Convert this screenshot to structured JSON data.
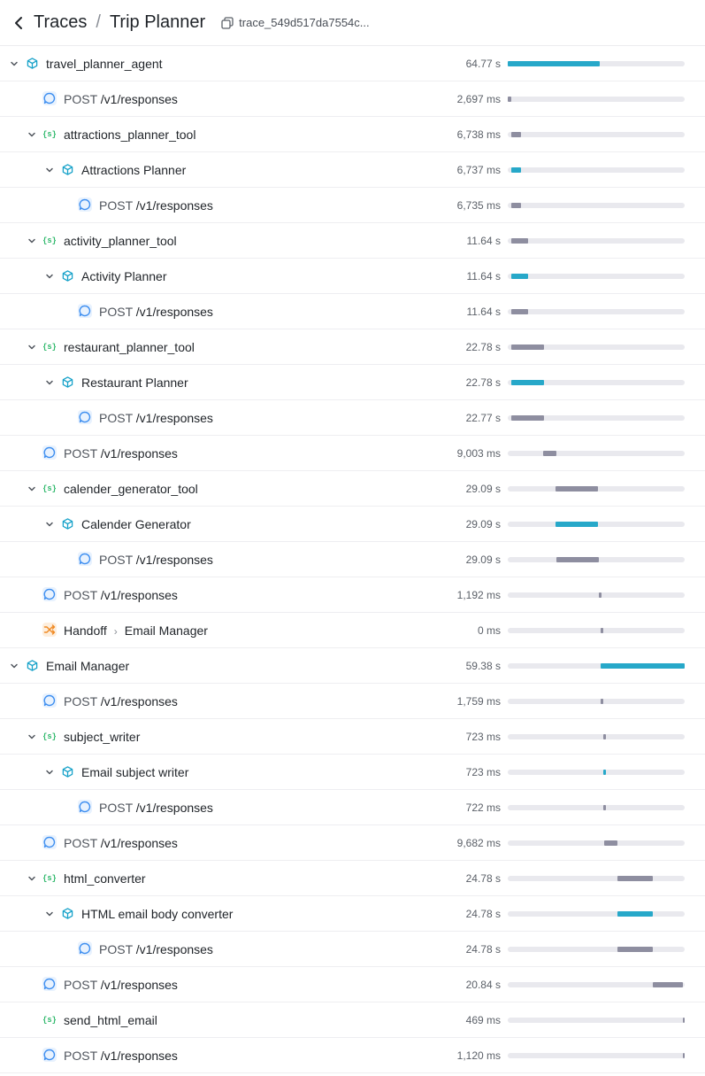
{
  "header": {
    "back_label": "Traces",
    "separator": "/",
    "title": "Trip Planner",
    "trace_id": "trace_549d517da7554c..."
  },
  "colors": {
    "agent_bar": "#27a8c9",
    "span_bar": "#8e8ea0",
    "track": "#e9e9ee",
    "agent_icon": "#17a2c9",
    "function_icon": "#2fb86b",
    "response_icon": "#3d8ef0",
    "handoff_icon": "#f08a24"
  },
  "spans": [
    {
      "type": "agent",
      "depth": 0,
      "expandable": true,
      "name": "travel_planner_agent",
      "duration": "64.77 s",
      "start_pct": 0.0,
      "width_pct": 52.0
    },
    {
      "type": "response",
      "depth": 1,
      "expandable": false,
      "method": "POST",
      "name": "/v1/responses",
      "duration": "2,697 ms",
      "start_pct": 0.0,
      "width_pct": 2.2
    },
    {
      "type": "function",
      "depth": 1,
      "expandable": true,
      "name": "attractions_planner_tool",
      "duration": "6,738 ms",
      "start_pct": 2.0,
      "width_pct": 5.5
    },
    {
      "type": "agent",
      "depth": 2,
      "expandable": true,
      "name": "Attractions Planner",
      "duration": "6,737 ms",
      "start_pct": 2.0,
      "width_pct": 5.5
    },
    {
      "type": "response",
      "depth": 3,
      "expandable": false,
      "method": "POST",
      "name": "/v1/responses",
      "duration": "6,735 ms",
      "start_pct": 2.0,
      "width_pct": 5.5
    },
    {
      "type": "function",
      "depth": 1,
      "expandable": true,
      "name": "activity_planner_tool",
      "duration": "11.64 s",
      "start_pct": 2.0,
      "width_pct": 9.5
    },
    {
      "type": "agent",
      "depth": 2,
      "expandable": true,
      "name": "Activity Planner",
      "duration": "11.64 s",
      "start_pct": 2.0,
      "width_pct": 9.5
    },
    {
      "type": "response",
      "depth": 3,
      "expandable": false,
      "method": "POST",
      "name": "/v1/responses",
      "duration": "11.64 s",
      "start_pct": 2.0,
      "width_pct": 9.5
    },
    {
      "type": "function",
      "depth": 1,
      "expandable": true,
      "name": "restaurant_planner_tool",
      "duration": "22.78 s",
      "start_pct": 2.0,
      "width_pct": 18.5
    },
    {
      "type": "agent",
      "depth": 2,
      "expandable": true,
      "name": "Restaurant Planner",
      "duration": "22.78 s",
      "start_pct": 2.0,
      "width_pct": 18.5
    },
    {
      "type": "response",
      "depth": 3,
      "expandable": false,
      "method": "POST",
      "name": "/v1/responses",
      "duration": "22.77 s",
      "start_pct": 2.0,
      "width_pct": 18.5
    },
    {
      "type": "response",
      "depth": 1,
      "expandable": false,
      "method": "POST",
      "name": "/v1/responses",
      "duration": "9,003 ms",
      "start_pct": 20.0,
      "width_pct": 7.3
    },
    {
      "type": "function",
      "depth": 1,
      "expandable": true,
      "name": "calender_generator_tool",
      "duration": "29.09 s",
      "start_pct": 27.0,
      "width_pct": 24.0
    },
    {
      "type": "agent",
      "depth": 2,
      "expandable": true,
      "name": "Calender Generator",
      "duration": "29.09 s",
      "start_pct": 27.0,
      "width_pct": 24.0
    },
    {
      "type": "response",
      "depth": 3,
      "expandable": false,
      "method": "POST",
      "name": "/v1/responses",
      "duration": "29.09 s",
      "start_pct": 27.5,
      "width_pct": 24.0
    },
    {
      "type": "response",
      "depth": 1,
      "expandable": false,
      "method": "POST",
      "name": "/v1/responses",
      "duration": "1,192 ms",
      "start_pct": 51.5,
      "width_pct": 1.0
    },
    {
      "type": "handoff",
      "depth": 1,
      "expandable": false,
      "name": "Handoff",
      "target": "Email Manager",
      "duration": "0 ms",
      "start_pct": 52.5,
      "width_pct": 1.0
    },
    {
      "type": "agent",
      "depth": 0,
      "expandable": true,
      "name": "Email Manager",
      "duration": "59.38 s",
      "start_pct": 52.5,
      "width_pct": 47.5
    },
    {
      "type": "response",
      "depth": 1,
      "expandable": false,
      "method": "POST",
      "name": "/v1/responses",
      "duration": "1,759 ms",
      "start_pct": 52.5,
      "width_pct": 1.5
    },
    {
      "type": "function",
      "depth": 1,
      "expandable": true,
      "name": "subject_writer",
      "duration": "723 ms",
      "start_pct": 54.0,
      "width_pct": 1.0
    },
    {
      "type": "agent",
      "depth": 2,
      "expandable": true,
      "name": "Email subject writer",
      "duration": "723 ms",
      "start_pct": 54.0,
      "width_pct": 1.0
    },
    {
      "type": "response",
      "depth": 3,
      "expandable": false,
      "method": "POST",
      "name": "/v1/responses",
      "duration": "722 ms",
      "start_pct": 54.0,
      "width_pct": 1.0
    },
    {
      "type": "response",
      "depth": 1,
      "expandable": false,
      "method": "POST",
      "name": "/v1/responses",
      "duration": "9,682 ms",
      "start_pct": 54.5,
      "width_pct": 7.5
    },
    {
      "type": "function",
      "depth": 1,
      "expandable": true,
      "name": "html_converter",
      "duration": "24.78 s",
      "start_pct": 62.0,
      "width_pct": 20.0
    },
    {
      "type": "agent",
      "depth": 2,
      "expandable": true,
      "name": "HTML email body converter",
      "duration": "24.78 s",
      "start_pct": 62.0,
      "width_pct": 20.0
    },
    {
      "type": "response",
      "depth": 3,
      "expandable": false,
      "method": "POST",
      "name": "/v1/responses",
      "duration": "24.78 s",
      "start_pct": 62.0,
      "width_pct": 20.0
    },
    {
      "type": "response",
      "depth": 1,
      "expandable": false,
      "method": "POST",
      "name": "/v1/responses",
      "duration": "20.84 s",
      "start_pct": 82.0,
      "width_pct": 17.0
    },
    {
      "type": "function",
      "depth": 1,
      "expandable": false,
      "name": "send_html_email",
      "duration": "469 ms",
      "start_pct": 99.0,
      "width_pct": 0.8
    },
    {
      "type": "response",
      "depth": 1,
      "expandable": false,
      "method": "POST",
      "name": "/v1/responses",
      "duration": "1,120 ms",
      "start_pct": 99.0,
      "width_pct": 0.9
    }
  ]
}
